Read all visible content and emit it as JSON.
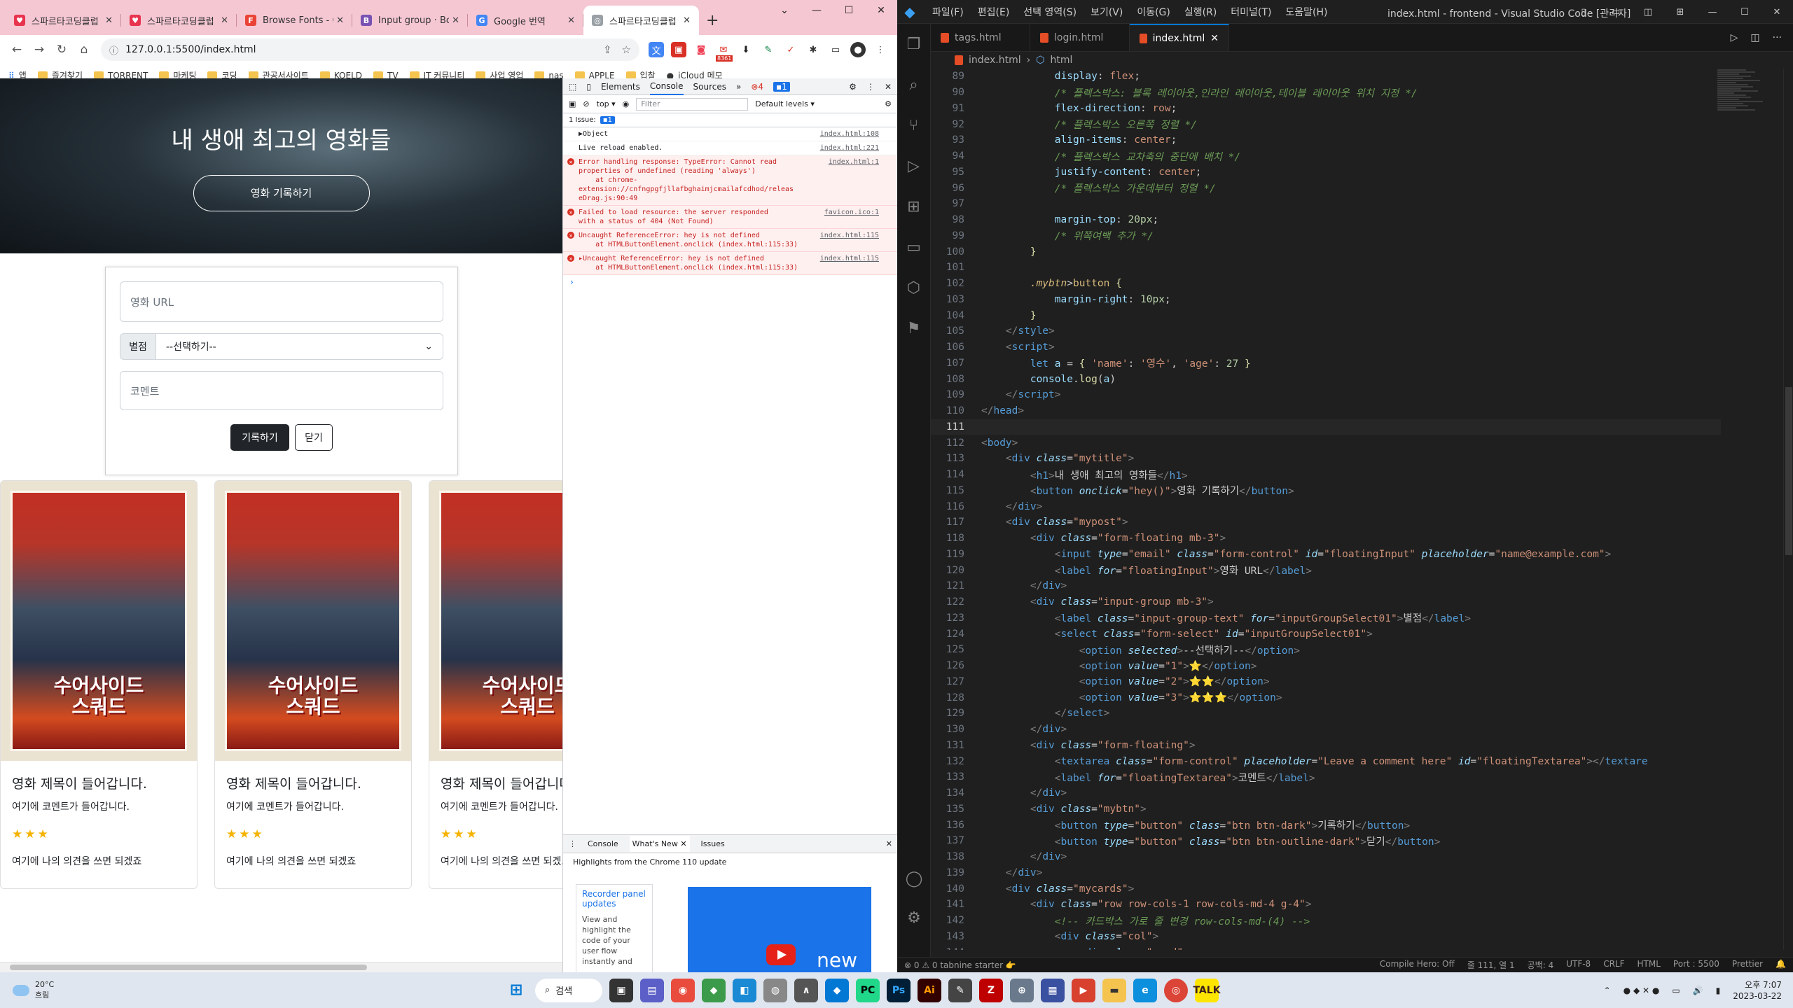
{
  "browser": {
    "tabs": [
      {
        "title": "스파르타코딩클럽",
        "fav_color": "#e8344e",
        "fav": "♥"
      },
      {
        "title": "스파르타코딩클럽",
        "fav_color": "#e8344e",
        "fav": "♥"
      },
      {
        "title": "Browse Fonts - Goo",
        "fav_color": "#ea4335",
        "fav": "F"
      },
      {
        "title": "Input group · Boot",
        "fav_color": "#7952b3",
        "fav": "B"
      },
      {
        "title": "Google 번역",
        "fav_color": "#4285f4",
        "fav": "G"
      },
      {
        "title": "스파르타코딩클럽",
        "fav_color": "#9aa0a6",
        "fav": "◎",
        "active": true
      }
    ],
    "url": "127.0.0.1:5500/index.html",
    "bookmarks": [
      "앱",
      "즐겨찾기",
      "TORRENT",
      "마케팅",
      "코딩",
      "관공서사이트",
      "KOELD",
      "TV",
      "IT 커뮤니티",
      "사업 영업",
      "nas",
      "APPLE",
      "입찰",
      "iCloud 메모"
    ],
    "ext_badge": "8361"
  },
  "page": {
    "hero_title": "내 생애 최고의 영화들",
    "hero_button": "영화 기록하기",
    "url_placeholder": "영화 URL",
    "star_label": "별점",
    "select_value": "--선택하기--",
    "comment_placeholder": "코멘트",
    "save_button": "기록하기",
    "close_button": "닫기",
    "cards": [
      {
        "title": "영화 제목이 들어갑니다.",
        "text": "여기에 코멘트가 들어갑니다.",
        "stars": "★★★",
        "comment": "여기에 나의 의견을 쓰면 되겠죠",
        "poster_title": "수어사이드\n스쿼드"
      },
      {
        "title": "영화 제목이 들어갑니다.",
        "text": "여기에 코멘트가 들어갑니다.",
        "stars": "★★★",
        "comment": "여기에 나의 의견을 쓰면 되겠죠",
        "poster_title": "수어사이드\n스쿼드"
      },
      {
        "title": "영화 제목이 들어갑니다.",
        "text": "여기에 코멘트가 들어갑니다.",
        "stars": "★★★",
        "comment": "여기에 나의 의견을 쓰면 되겠죠",
        "poster_title": "수어사이드\n스쿼드"
      }
    ]
  },
  "devtools": {
    "tabs": [
      "Elements",
      "Console",
      "Sources"
    ],
    "errors_count": "4",
    "info_count": "1",
    "context": "top ▾",
    "filter_placeholder": "Filter",
    "levels": "Default levels ▾",
    "issues": "1 Issue:",
    "issues_count": "1",
    "logs": [
      {
        "type": "log",
        "msg": "▶Object",
        "src": "index.html:108"
      },
      {
        "type": "log",
        "msg": "Live reload enabled.",
        "src": "index.html:221"
      },
      {
        "type": "err",
        "msg": "Error handling response: TypeError: Cannot read\nproperties of undefined (reading 'always')\n    at chrome-extension://cnfngpgfjllafbghaimjcmailafcdhod/releas\neDrag.js:90:49",
        "src": "index.html:1"
      },
      {
        "type": "err",
        "msg": "Failed to load resource: the server responded\nwith a status of 404 (Not Found)",
        "src": "favicon.ico:1"
      },
      {
        "type": "err",
        "msg": "Uncaught ReferenceError: hey is not defined\n    at HTMLButtonElement.onclick (index.html:115:33)",
        "src": "index.html:115"
      },
      {
        "type": "err",
        "msg": "▸Uncaught ReferenceError: hey is not defined\n    at HTMLButtonElement.onclick (index.html:115:33)",
        "src": "index.html:115"
      }
    ],
    "drawer_tabs": [
      "Console",
      "What's New",
      "Issues"
    ],
    "drawer_head": "Highlights from the Chrome 110 update",
    "wn_title": "Recorder panel updates",
    "wn_desc": "View and highlight the code of your user flow instantly and",
    "wn_new": "new"
  },
  "vscode": {
    "menu": [
      "파일(F)",
      "편집(E)",
      "선택 영역(S)",
      "보기(V)",
      "이동(G)",
      "실행(R)",
      "터미널(T)",
      "도움말(H)"
    ],
    "window_title": "index.html - frontend - Visual Studio Code [관리자]",
    "tabs": [
      "tags.html",
      "login.html",
      "index.html"
    ],
    "breadcrumb": [
      "index.html",
      "html"
    ],
    "status_left": "⊗ 0 ⚠ 0   tabnine starter 👉",
    "status_right": [
      "Compile Hero: Off",
      "줄 111, 열 1",
      "공백: 4",
      "UTF-8",
      "CRLF",
      "HTML",
      "Port : 5500",
      "Prettier"
    ]
  },
  "taskbar": {
    "weather_temp": "20°C",
    "weather_desc": "흐림",
    "search": "검색",
    "time": "오후 7:07",
    "date": "2023-03-22"
  }
}
